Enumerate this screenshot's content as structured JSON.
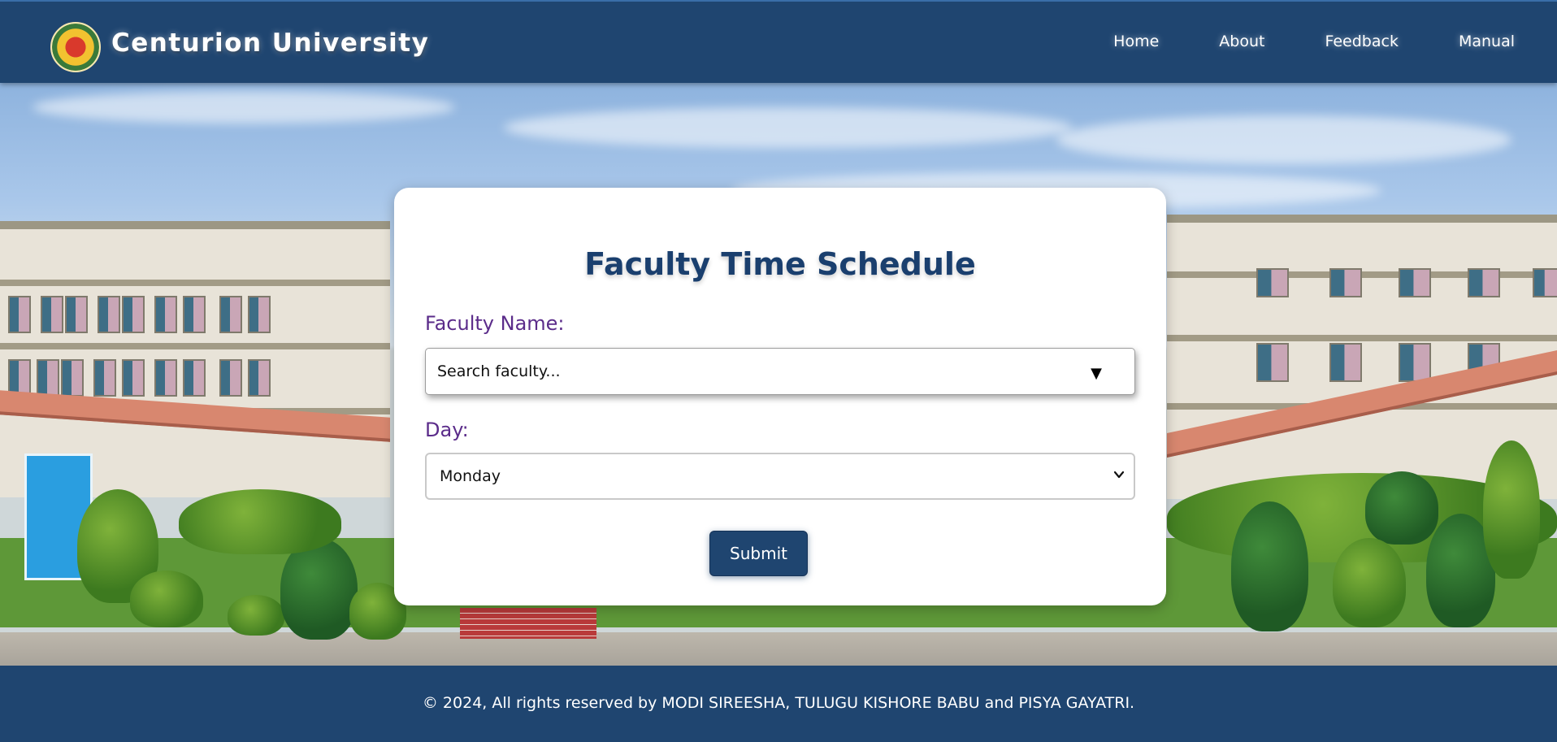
{
  "header": {
    "brand": "Centurion University",
    "nav": [
      "Home",
      "About",
      "Feedback",
      "Manual"
    ]
  },
  "form": {
    "title": "Faculty Time Schedule",
    "faculty_label": "Faculty Name:",
    "faculty_placeholder": "Search faculty...",
    "day_label": "Day:",
    "day_value": "Monday",
    "submit_label": "Submit"
  },
  "footer": {
    "copyright": "© 2024, All rights reserved by MODI SIREESHA, TULUGU KISHORE BABU and PISYA GAYATRI."
  },
  "colors": {
    "primary": "#1f4570",
    "title": "#1a3f6e",
    "label": "#5b2c8a"
  }
}
